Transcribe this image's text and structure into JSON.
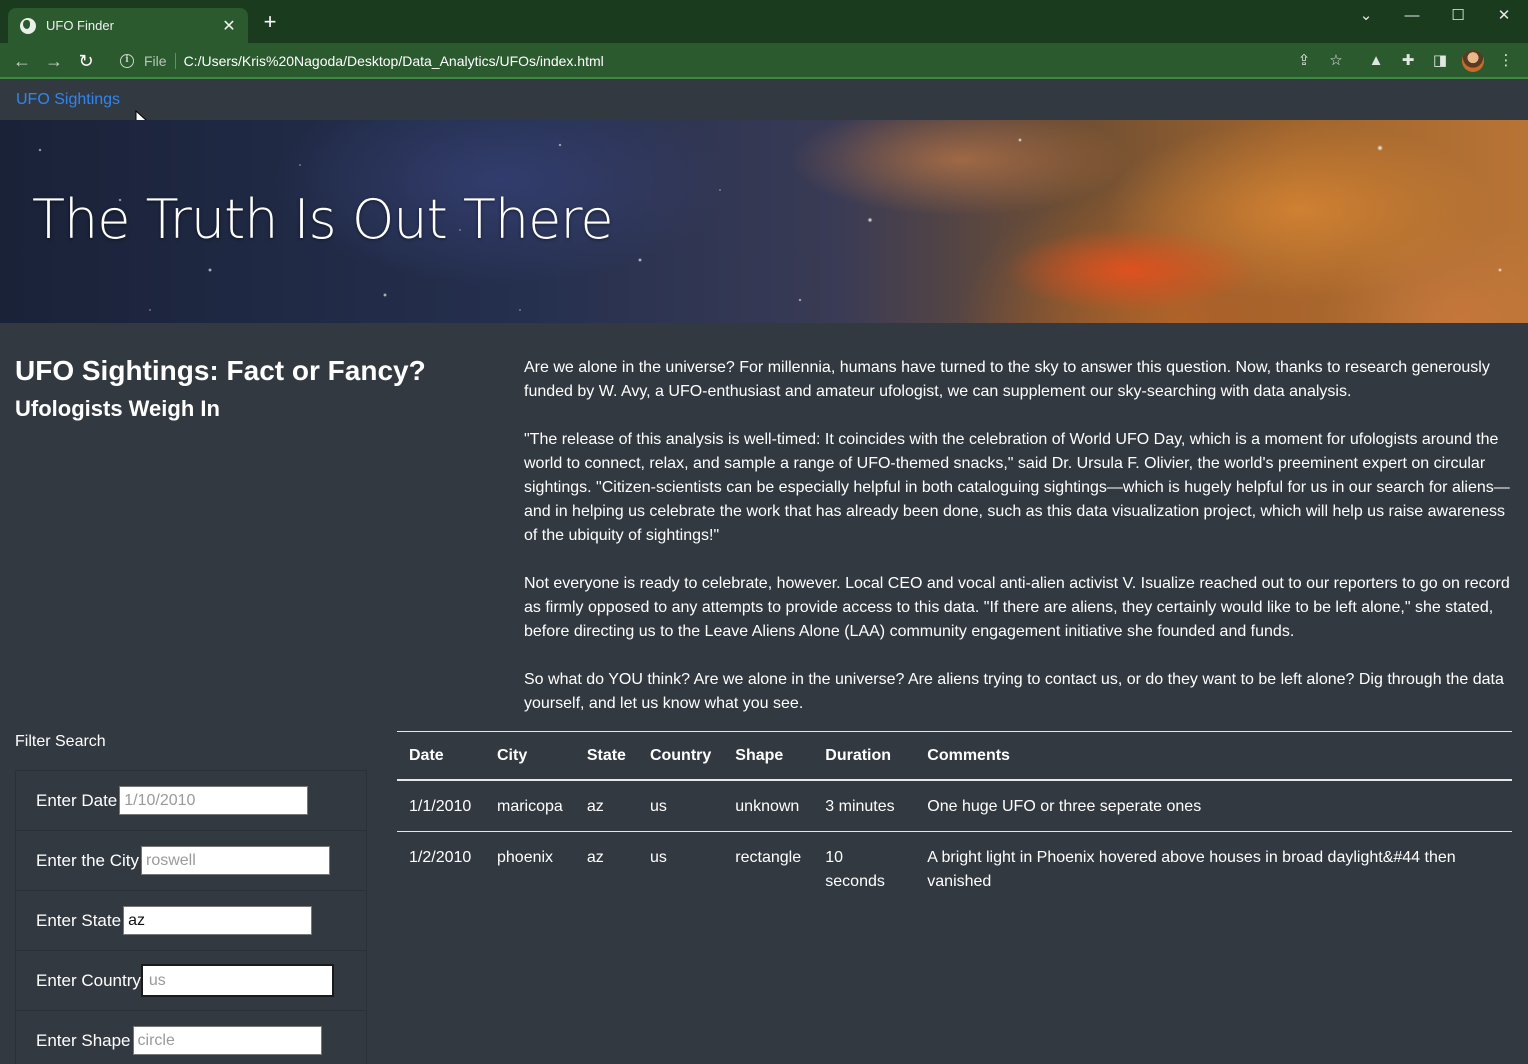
{
  "browser": {
    "tab_title": "UFO Finder",
    "file_label": "File",
    "url": "C:/Users/Kris%20Nagoda/Desktop/Data_Analytics/UFOs/index.html"
  },
  "navbar": {
    "brand": "UFO Sightings"
  },
  "hero": {
    "title": "The Truth Is Out There"
  },
  "intro": {
    "heading": "UFO Sightings: Fact or Fancy?",
    "subheading": "Ufologists Weigh In",
    "paragraphs": [
      "Are we alone in the universe? For millennia, humans have turned to the sky to answer this question. Now, thanks to research generously funded by W. Avy, a UFO-enthusiast and amateur ufologist, we can supplement our sky-searching with data analysis.",
      "\"The release of this analysis is well-timed: It coincides with the celebration of World UFO Day, which is a moment for ufologists around the world to connect, relax, and sample a range of UFO-themed snacks,\" said Dr. Ursula F. Olivier, the world's preeminent expert on circular sightings. \"Citizen-scientists can be especially helpful in both cataloguing sightings—which is hugely helpful for us in our search for aliens—and in helping us celebrate the work that has already been done, such as this data visualization project, which will help us raise awareness of the ubiquity of sightings!\"",
      "Not everyone is ready to celebrate, however. Local CEO and vocal anti-alien activist V. Isualize reached out to our reporters to go on record as firmly opposed to any attempts to provide access to this data. \"If there are aliens, they certainly would like to be left alone,\" she stated, before directing us to the Leave Aliens Alone (LAA) community engagement initiative she founded and funds.",
      "So what do YOU think? Are we alone in the universe? Are aliens trying to contact us, or do they want to be left alone? Dig through the data yourself, and let us know what you see."
    ]
  },
  "filters": {
    "title": "Filter Search",
    "items": [
      {
        "label": "Enter Date",
        "value": "",
        "placeholder": "1/10/2010"
      },
      {
        "label": "Enter the City",
        "value": "",
        "placeholder": "roswell"
      },
      {
        "label": "Enter State",
        "value": "az",
        "placeholder": ""
      },
      {
        "label": "Enter Country",
        "value": "",
        "placeholder": "us"
      },
      {
        "label": "Enter Shape",
        "value": "",
        "placeholder": "circle"
      }
    ]
  },
  "table": {
    "headers": [
      "Date",
      "City",
      "State",
      "Country",
      "Shape",
      "Duration",
      "Comments"
    ],
    "rows": [
      [
        "1/1/2010",
        "maricopa",
        "az",
        "us",
        "unknown",
        "3 minutes",
        "One huge UFO or three seperate ones"
      ],
      [
        "1/2/2010",
        "phoenix",
        "az",
        "us",
        "rectangle",
        "10 seconds",
        "A bright light in Phoenix hovered above houses in broad daylight&#44 then vanished"
      ]
    ]
  },
  "colors": {
    "page_bg": "#333940",
    "brand_link": "#2f86f0",
    "browser_frame": "#2b5a2f"
  }
}
